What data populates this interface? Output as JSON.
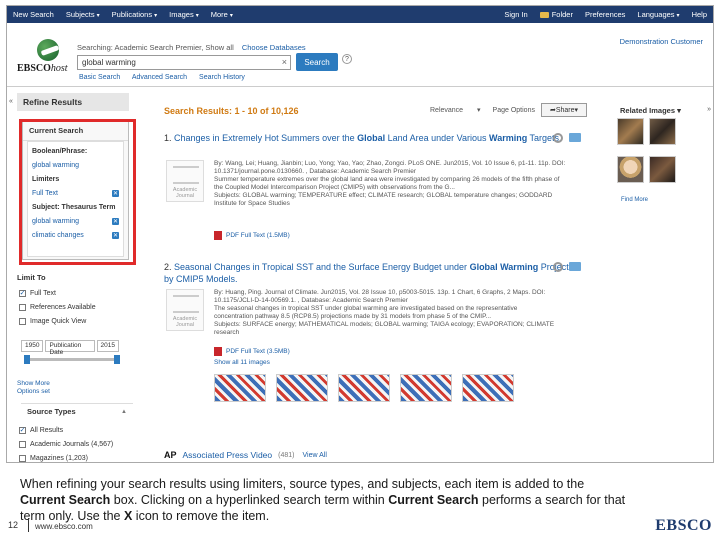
{
  "topbar": {
    "items": [
      {
        "label": "New Search",
        "caret": false
      },
      {
        "label": "Subjects",
        "caret": true
      },
      {
        "label": "Publications",
        "caret": true
      },
      {
        "label": "Images",
        "caret": true
      },
      {
        "label": "More",
        "caret": true
      }
    ],
    "right": [
      {
        "label": "Sign In"
      },
      {
        "label": "Folder"
      },
      {
        "label": "Preferences"
      },
      {
        "label": "Languages",
        "caret": true
      },
      {
        "label": "Help"
      }
    ]
  },
  "header": {
    "logo_main": "EBSCO",
    "logo_host": "host",
    "searching_prefix": "Searching:",
    "database": "Academic Search Premier, Show all",
    "choose_db": "Choose Databases",
    "search_value": "global warming",
    "search_button": "Search",
    "links": [
      "Basic Search",
      "Advanced Search",
      "Search History"
    ],
    "institution": "Demonstration Customer"
  },
  "left": {
    "refine_title": "Refine Results",
    "current_search_heading": "Current Search",
    "boolean_label": "Boolean/Phrase:",
    "boolean_term": "global warming",
    "limiters_label": "Limiters",
    "limiter_term": "Full Text",
    "subject_label": "Subject: Thesaurus Term",
    "subject_terms": [
      "global warming",
      "climatic changes"
    ],
    "limit_to": "Limit To",
    "checkboxes": [
      {
        "label": "Full Text",
        "checked": true
      },
      {
        "label": "References Available",
        "checked": false
      },
      {
        "label": "Image Quick View",
        "checked": false
      }
    ],
    "pubdate_from": "1950",
    "pubdate_label": "Publication Date",
    "pubdate_to": "2015",
    "show_more": "Show More",
    "options_set": "Options set",
    "source_types": "Source Types",
    "source_items": [
      {
        "label": "All Results",
        "checked": true
      },
      {
        "label": "Academic Journals (4,567)",
        "checked": false
      },
      {
        "label": "Magazines (1,203)",
        "checked": false
      }
    ]
  },
  "results": {
    "heading": "Search Results: 1 - 10 of 10,126",
    "tools": [
      "Relevance",
      "Page Options"
    ],
    "share": "Share",
    "items": [
      {
        "num": "1.",
        "title_pre": "Changes in Extremely Hot Summers over the ",
        "title_bold": "Global",
        "title_mid": " Land Area under Various ",
        "title_bold2": "Warming",
        "title_post": " Targets.",
        "meta1": "By: Wang, Lei; Huang, Jianbin; Luo, Yong; Yao, Yao; Zhao, Zongci. PLoS ONE. Jun2015, Vol. 10 Issue 6, p1-11. 11p. DOI:",
        "meta2": "10.1371/journal.pone.0130660. , Database: Academic Search Premier",
        "meta3": "Summer temperature extremes over the global land area were investigated by comparing 26 models of the fifth phase of",
        "meta4": "the Coupled Model Intercomparison Project (CMIP5) with observations from the G...",
        "meta5": "Subjects: GLOBAL warming; TEMPERATURE effect; CLIMATE research; GLOBAL temperature changes; GODDARD",
        "meta6": "Institute for Space Studies",
        "pdf": "PDF Full Text (1.5MB)",
        "thumb_caption": "Academic Journal"
      },
      {
        "num": "2.",
        "title_pre": "Seasonal Changes in Tropical SST and the Surface Energy Budget under ",
        "title_bold": "Global Warming",
        "title_mid": " Projected by CMIP5 Models.",
        "meta1": "By: Huang, Ping. Journal of Climate. Jun2015, Vol. 28 Issue 10, p5003-5015. 13p. 1 Chart, 6 Graphs, 2 Maps. DOI:",
        "meta2": "10.1175/JCLI-D-14-00569.1. , Database: Academic Search Premier",
        "meta3": "The seasonal changes in tropical SST under global warming are investigated based on the representative",
        "meta4": "concentration pathway 8.5 (RCP8.5) projections made by 31 models from phase 5 of the CMIP...",
        "meta5": "Subjects: SURFACE energy; MATHEMATICAL models; GLOBAL warming; TAIGA ecology; EVAPORATION; CLIMATE",
        "meta6": "research",
        "pdf": "PDF Full Text (3.5MB)",
        "show_images": "Show all 11 images",
        "thumb_caption": "Academic Journal"
      }
    ],
    "ap_label": "AP",
    "ap_title": "Associated Press Video",
    "ap_count": "(481)",
    "ap_view": "View All"
  },
  "right": {
    "related": "Related Images",
    "photo_caption": "Find More"
  },
  "caption": {
    "line1": "When refining your search results using limiters, source types, and subjects, each item is added to the",
    "line2_bold1": "Current Search",
    "line2_mid": " box. Clicking on a hyperlinked search term within ",
    "line2_bold2": "Current Search",
    "line2_post": " performs a search for that",
    "line3_pre": "term only. Use the ",
    "line3_bold": "X",
    "line3_post": " icon to remove the item."
  },
  "footer": {
    "page": "12",
    "url": "www.ebsco.com",
    "logo": "EBSCO"
  },
  "colors": {
    "accent": "#1b5ea6",
    "results_heading": "#d07a12",
    "highlight": "#e02a2a",
    "topbar": "#1f3c6e"
  }
}
